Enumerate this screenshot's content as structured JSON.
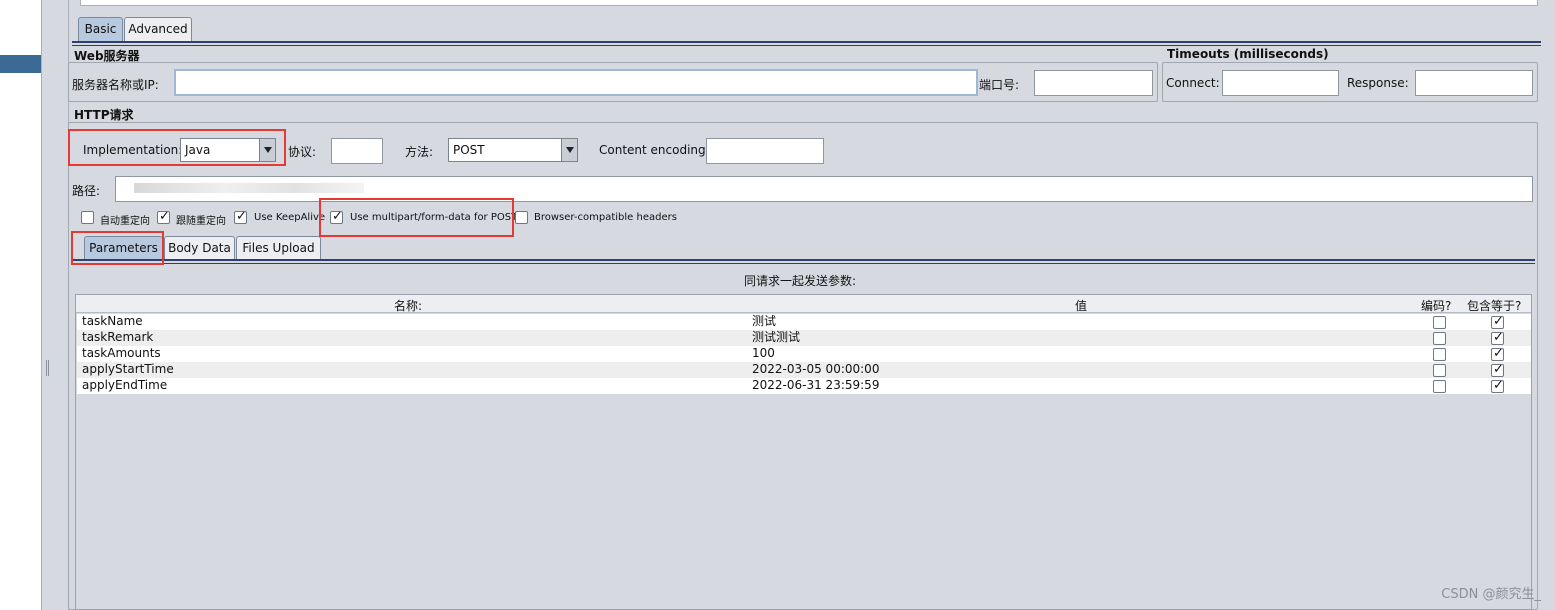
{
  "tabs": {
    "basic": "Basic",
    "advanced": "Advanced"
  },
  "web_server": {
    "title": "Web服务器",
    "server_label": "服务器名称或IP:",
    "server_value": "",
    "port_label": "端口号:",
    "port_value": ""
  },
  "timeouts": {
    "title": "Timeouts (milliseconds)",
    "connect_label": "Connect:",
    "connect_value": "",
    "response_label": "Response:",
    "response_value": ""
  },
  "http_request": {
    "title": "HTTP请求",
    "implementation_label": "Implementation:",
    "implementation_value": "Java",
    "protocol_label": "协议:",
    "protocol_value": "",
    "method_label": "方法:",
    "method_value": "POST",
    "encoding_label": "Content encoding:",
    "encoding_value": "",
    "path_label": "路径:"
  },
  "options": [
    {
      "label": "自动重定向",
      "checked": false
    },
    {
      "label": "跟随重定向",
      "checked": true
    },
    {
      "label": "Use KeepAlive",
      "checked": true
    },
    {
      "label": "Use multipart/form-data for POST",
      "checked": true
    },
    {
      "label": "Browser-compatible headers",
      "checked": false
    }
  ],
  "subtabs": {
    "parameters": "Parameters",
    "body_data": "Body Data",
    "files_upload": "Files Upload"
  },
  "params": {
    "caption": "同请求一起发送参数:",
    "columns": {
      "name": "名称:",
      "value": "值",
      "encode": "编码?",
      "include_equals": "包含等于?"
    },
    "rows": [
      {
        "name": "taskName",
        "value": "测试",
        "encode": false,
        "include_equals": true
      },
      {
        "name": "taskRemark",
        "value": "测试测试",
        "encode": false,
        "include_equals": true
      },
      {
        "name": "taskAmounts",
        "value": "100",
        "encode": false,
        "include_equals": true
      },
      {
        "name": "applyStartTime",
        "value": "2022-03-05 00:00:00",
        "encode": false,
        "include_equals": true
      },
      {
        "name": "applyEndTime",
        "value": "2022-06-31 23:59:59",
        "encode": false,
        "include_equals": true
      }
    ]
  },
  "watermark": "CSDN @颜究生_",
  "colors": {
    "highlight": "#e53935",
    "panel": "#d6d9df",
    "active_tab": "#b7c9de",
    "accent": "#3b6a94"
  }
}
